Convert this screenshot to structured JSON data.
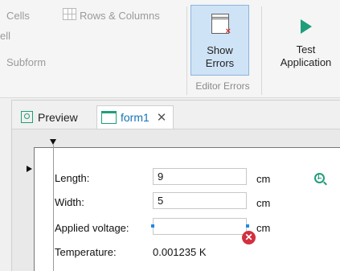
{
  "ribbon": {
    "cells_label": "Cells",
    "partial_label": "ell",
    "subform_label": "Subform",
    "rows_columns_label": "Rows & Columns",
    "show_errors_label_line1": "Show",
    "show_errors_label_line2": "Errors",
    "group_label": "Editor Errors",
    "test_app_label_line1": "Test",
    "test_app_label_line2": "Application"
  },
  "tabs": [
    {
      "label": "Preview",
      "icon": "preview-icon"
    },
    {
      "label": "form1",
      "icon": "form-icon",
      "close": "✕"
    }
  ],
  "form": {
    "length_label": "Length:",
    "length_value": "9",
    "length_unit": "cm",
    "width_label": "Width:",
    "width_value": "5",
    "width_unit": "cm",
    "voltage_label": "Applied voltage:",
    "voltage_value": "",
    "voltage_unit": "cm",
    "temperature_label": "Temperature:",
    "temperature_value": "0.001235 K"
  },
  "colors": {
    "accent_green": "#1f9e7a",
    "tab_blue": "#1573b9",
    "error_red": "#d32f3f",
    "selected_button": "#cfe3f6"
  }
}
